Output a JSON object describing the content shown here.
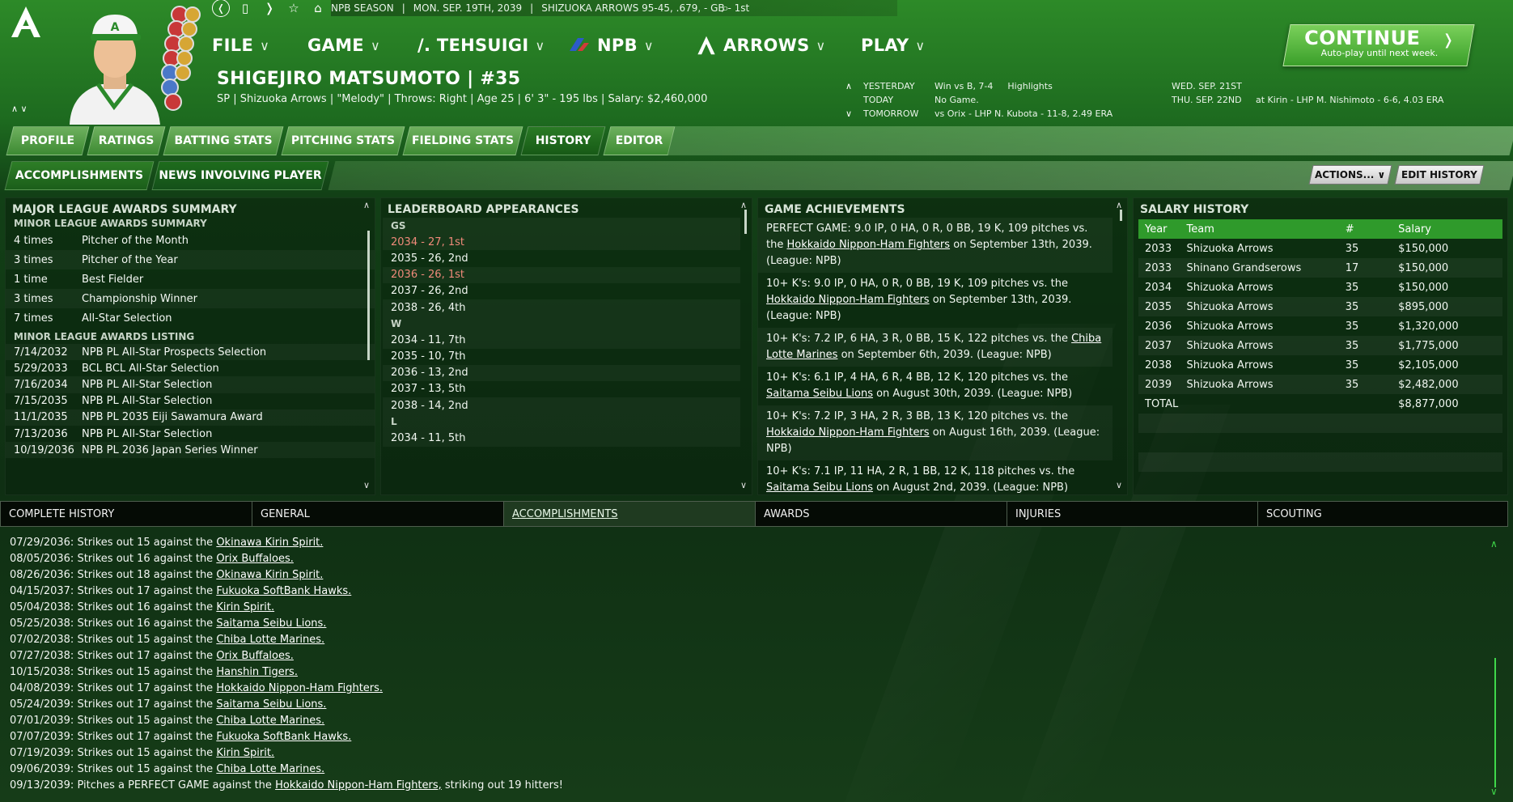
{
  "colors": {
    "accent": "#2f9a2b",
    "highlight": "#f08a7a",
    "background": "#0f2d12"
  },
  "topbar": {
    "icons": [
      "back-icon",
      "page-icon",
      "forward-icon",
      "star-icon",
      "home-icon",
      "search-icon"
    ],
    "season": "NPB SEASON",
    "date": "MON. SEP. 19TH, 2039",
    "team_record": "SHIZUOKA ARROWS  95-45, .679, - GB - 1st"
  },
  "menu": [
    {
      "label": "FILE"
    },
    {
      "label": "GAME"
    },
    {
      "label": "/. TEHSUIGI"
    },
    {
      "label": "NPB"
    },
    {
      "label": "ARROWS"
    },
    {
      "label": "PLAY"
    }
  ],
  "continue": {
    "label": "CONTINUE",
    "sub": "Auto-play until next week."
  },
  "player": {
    "name": "SHIGEJIRO MATSUMOTO  |  #35",
    "info": "SP | Shizuoka Arrows  |  \"Melody\" | Throws: Right  |  Age 25  |  6' 3\" - 195 lbs  |  Salary: $2,460,000"
  },
  "schedule": {
    "yesterday_label": "YESTERDAY",
    "yesterday": "Win vs B, 7-4",
    "highlights": "Highlights",
    "today_label": "TODAY",
    "today": "No Game.",
    "tomorrow_label": "TOMORROW",
    "tomorrow": "vs Orix - LHP N. Kubota - 11-8, 2.49 ERA",
    "d1": "WED. SEP. 21ST",
    "d1v": "",
    "d2": "THU. SEP. 22ND",
    "d2v": "at Kirin - LHP M. Nishimoto - 6-6, 4.03 ERA"
  },
  "tabs": [
    "PROFILE",
    "RATINGS",
    "BATTING STATS",
    "PITCHING STATS",
    "FIELDING STATS",
    "HISTORY",
    "EDITOR"
  ],
  "subtabs": [
    "ACCOMPLISHMENTS",
    "NEWS INVOLVING PLAYER"
  ],
  "actions_label": "ACTIONS...",
  "edit_history_label": "EDIT HISTORY",
  "awards": {
    "title": "MAJOR LEAGUE AWARDS SUMMARY",
    "minor_summary_title": "MINOR LEAGUE AWARDS SUMMARY",
    "summary": [
      [
        "4 times",
        "Pitcher of the Month"
      ],
      [
        "3 times",
        "Pitcher of the Year"
      ],
      [
        "1 time",
        "Best Fielder"
      ],
      [
        "3 times",
        "Championship Winner"
      ],
      [
        "7 times",
        "All-Star Selection"
      ]
    ],
    "listing_title": "MINOR LEAGUE AWARDS LISTING",
    "listing": [
      [
        "7/14/2032",
        "NPB PL All-Star Prospects Selection"
      ],
      [
        "5/29/2033",
        "BCL BCL All-Star Selection"
      ],
      [
        "7/16/2034",
        "NPB PL All-Star Selection"
      ],
      [
        "7/15/2035",
        "NPB PL All-Star Selection"
      ],
      [
        "11/1/2035",
        "NPB PL 2035 Eiji Sawamura Award"
      ],
      [
        "7/13/2036",
        "NPB PL All-Star Selection"
      ],
      [
        "10/19/2036",
        "NPB PL 2036 Japan Series Winner"
      ]
    ]
  },
  "leaderboard": {
    "title": "LEADERBOARD APPEARANCES",
    "rows": [
      {
        "t": "head",
        "text": "GS"
      },
      {
        "t": "hl",
        "text": "2034 - 27, 1st"
      },
      {
        "t": "row",
        "text": "2035 - 26, 2nd"
      },
      {
        "t": "hl",
        "text": "2036 - 26, 1st"
      },
      {
        "t": "row",
        "text": "2037 - 26, 2nd"
      },
      {
        "t": "row",
        "text": "2038 - 26, 4th"
      },
      {
        "t": "head",
        "text": "W"
      },
      {
        "t": "row",
        "text": "2034 - 11, 7th"
      },
      {
        "t": "row",
        "text": "2035 - 10, 7th"
      },
      {
        "t": "row",
        "text": "2036 - 13, 2nd"
      },
      {
        "t": "row",
        "text": "2037 - 13, 5th"
      },
      {
        "t": "row",
        "text": "2038 - 14, 2nd"
      },
      {
        "t": "head",
        "text": "L"
      },
      {
        "t": "row",
        "text": "2034 - 11, 5th"
      }
    ]
  },
  "game_achievements": {
    "title": "GAME ACHIEVEMENTS",
    "items": [
      {
        "pre": "PERFECT GAME: 9.0 IP, 0 HA, 0 R, 0 BB, 19 K, 109 pitches vs. the ",
        "team": "Hokkaido Nippon-Ham Fighters",
        "post": " on September 13th, 2039. (League: NPB)"
      },
      {
        "pre": "10+ K's: 9.0 IP, 0 HA, 0 R, 0 BB, 19 K, 109 pitches vs. the ",
        "team": "Hokkaido Nippon-Ham Fighters",
        "post": " on September 13th, 2039. (League: NPB)"
      },
      {
        "pre": "10+ K's: 7.2 IP, 6 HA, 3 R, 0 BB, 15 K, 122 pitches vs. the ",
        "team": "Chiba Lotte Marines",
        "post": " on September 6th, 2039. (League: NPB)"
      },
      {
        "pre": "10+ K's: 6.1 IP, 4 HA, 6 R, 4 BB, 12 K, 120 pitches vs. the ",
        "team": "Saitama Seibu Lions",
        "post": " on August 30th, 2039. (League: NPB)"
      },
      {
        "pre": "10+ K's: 7.2 IP, 3 HA, 2 R, 3 BB, 13 K, 120 pitches vs. the ",
        "team": "Hokkaido Nippon-Ham Fighters",
        "post": " on August 16th, 2039. (League: NPB)"
      },
      {
        "pre": "10+ K's: 7.1 IP, 11 HA, 2 R, 1 BB, 12 K, 118 pitches vs. the ",
        "team": "Saitama Seibu Lions",
        "post": " on August 2nd, 2039. (League: NPB)"
      }
    ]
  },
  "salary": {
    "title": "SALARY HISTORY",
    "headers": [
      "Year",
      "Team",
      "#",
      "Salary"
    ],
    "rows": [
      [
        "2033",
        "Shizuoka Arrows",
        "35",
        "$150,000"
      ],
      [
        "2033",
        "Shinano Grandserows",
        "17",
        "$150,000"
      ],
      [
        "2034",
        "Shizuoka Arrows",
        "35",
        "$150,000"
      ],
      [
        "2035",
        "Shizuoka Arrows",
        "35",
        "$895,000"
      ],
      [
        "2036",
        "Shizuoka Arrows",
        "35",
        "$1,320,000"
      ],
      [
        "2037",
        "Shizuoka Arrows",
        "35",
        "$1,775,000"
      ],
      [
        "2038",
        "Shizuoka Arrows",
        "35",
        "$2,105,000"
      ],
      [
        "2039",
        "Shizuoka Arrows",
        "35",
        "$2,482,000"
      ]
    ],
    "total_label": "TOTAL",
    "total": "$8,877,000"
  },
  "bottom_tabs": [
    "COMPLETE HISTORY",
    "GENERAL",
    "ACCOMPLISHMENTS",
    "AWARDS",
    "INJURIES",
    "SCOUTING"
  ],
  "log": [
    {
      "pre": "07/29/2036: Strikes out 15 against the ",
      "team": "Okinawa Kirin Spirit.",
      "post": ""
    },
    {
      "pre": "08/05/2036: Strikes out 16 against the ",
      "team": "Orix Buffaloes.",
      "post": ""
    },
    {
      "pre": "08/26/2036: Strikes out 18 against the ",
      "team": "Okinawa Kirin Spirit.",
      "post": ""
    },
    {
      "pre": "04/15/2037: Strikes out 17 against the ",
      "team": "Fukuoka SoftBank Hawks.",
      "post": ""
    },
    {
      "pre": "05/04/2038: Strikes out 16 against the ",
      "team": "Kirin Spirit.",
      "post": ""
    },
    {
      "pre": "05/25/2038: Strikes out 16 against the ",
      "team": "Saitama Seibu Lions.",
      "post": ""
    },
    {
      "pre": "07/02/2038: Strikes out 15 against the ",
      "team": "Chiba Lotte Marines.",
      "post": ""
    },
    {
      "pre": "07/27/2038: Strikes out 17 against the ",
      "team": "Orix Buffaloes.",
      "post": ""
    },
    {
      "pre": "10/15/2038: Strikes out 15 against the ",
      "team": "Hanshin Tigers.",
      "post": ""
    },
    {
      "pre": "04/08/2039: Strikes out 17 against the ",
      "team": "Hokkaido Nippon-Ham Fighters.",
      "post": ""
    },
    {
      "pre": "05/24/2039: Strikes out 17 against the ",
      "team": "Saitama Seibu Lions.",
      "post": ""
    },
    {
      "pre": "07/01/2039: Strikes out 15 against the ",
      "team": "Chiba Lotte Marines.",
      "post": ""
    },
    {
      "pre": "07/07/2039: Strikes out 17 against the ",
      "team": "Fukuoka SoftBank Hawks.",
      "post": ""
    },
    {
      "pre": "07/19/2039: Strikes out 15 against the ",
      "team": "Kirin Spirit.",
      "post": ""
    },
    {
      "pre": "09/06/2039: Strikes out 15 against the ",
      "team": "Chiba Lotte Marines.",
      "post": ""
    },
    {
      "pre": "09/13/2039: Pitches a PERFECT GAME against the ",
      "team": "Hokkaido Nippon-Ham Fighters,",
      "post": " striking out 19 hitters!"
    }
  ]
}
